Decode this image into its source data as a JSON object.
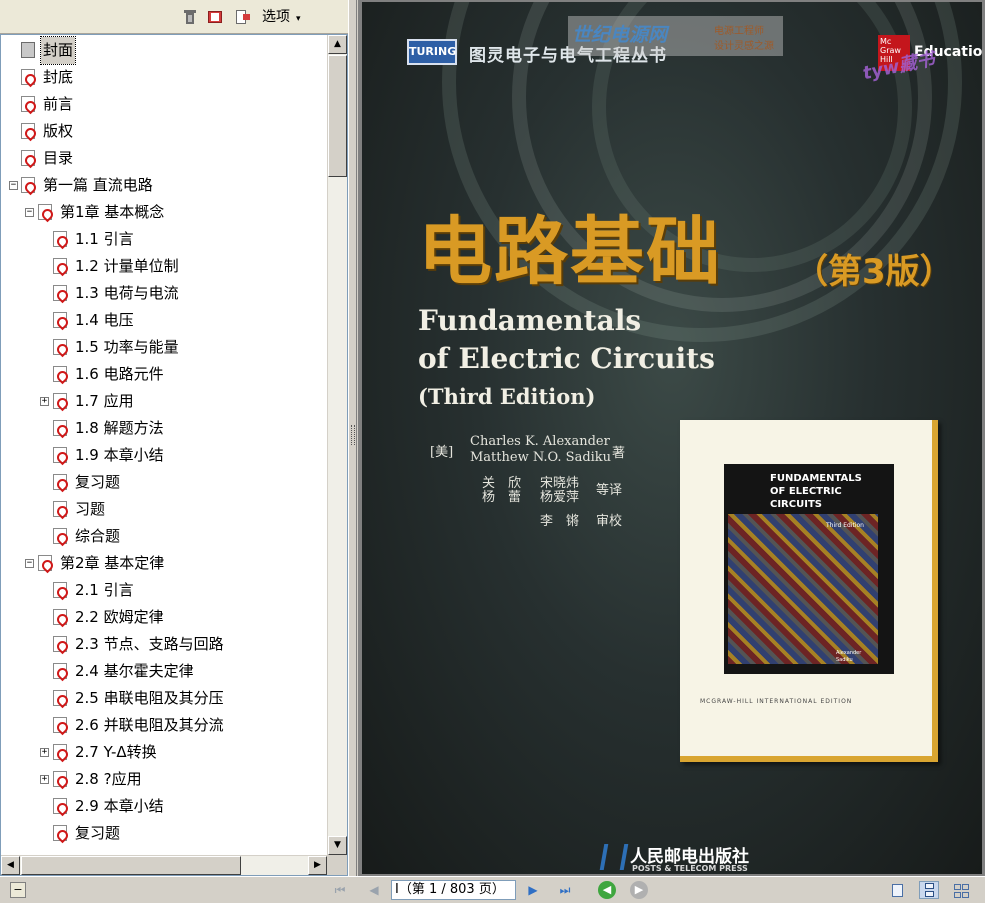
{
  "bookmarks_toolbar": {
    "options_label": "选项",
    "options_arrow": "▾"
  },
  "tree": {
    "items": [
      {
        "label": "封面",
        "selected": true
      },
      {
        "label": "封底"
      },
      {
        "label": "前言"
      },
      {
        "label": "版权"
      },
      {
        "label": "目录"
      },
      {
        "label": "第一篇 直流电路",
        "expander": "−"
      },
      {
        "label": "第1章 基本概念",
        "expander": "−"
      },
      {
        "label": "1.1 引言"
      },
      {
        "label": "1.2 计量单位制"
      },
      {
        "label": "1.3 电荷与电流"
      },
      {
        "label": "1.4 电压"
      },
      {
        "label": "1.5 功率与能量"
      },
      {
        "label": "1.6 电路元件"
      },
      {
        "label": "1.7 应用",
        "expander": "+"
      },
      {
        "label": "1.8 解题方法"
      },
      {
        "label": "1.9 本章小结"
      },
      {
        "label": "复习题"
      },
      {
        "label": "习题"
      },
      {
        "label": "综合题"
      },
      {
        "label": "第2章 基本定律",
        "expander": "−"
      },
      {
        "label": "2.1 引言"
      },
      {
        "label": "2.2 欧姆定律"
      },
      {
        "label": "2.3 节点、支路与回路"
      },
      {
        "label": "2.4 基尔霍夫定律"
      },
      {
        "label": "2.5 串联电阻及其分压"
      },
      {
        "label": "2.6 并联电阻及其分流"
      },
      {
        "label": "2.7 Y-Δ转换",
        "expander": "+"
      },
      {
        "label": "2.8 ?应用",
        "expander": "+"
      },
      {
        "label": "2.9 本章小结"
      },
      {
        "label": "复习题"
      }
    ]
  },
  "cover": {
    "series_badge": "TURING",
    "series_title": "图灵电子与电气工程丛书",
    "watermark_main": "世纪电源网",
    "watermark_sub1": "电源工程师",
    "watermark_sub2": "设计灵感之源",
    "mcgraw_logo": "Mc Graw Hill",
    "education": "Education",
    "stamp": "tyw藏书",
    "title_cn": "电路基础",
    "edition_cn": "（第3版）",
    "title_en_1": "Fundamentals",
    "title_en_2": "of Electric Circuits",
    "title_en_3": "(Third Edition)",
    "nationality": "[美]",
    "author1": "Charles K. Alexander",
    "author2": "Matthew N.O. Sadiku",
    "author_suffix": "著",
    "translator_1a": "关　欣",
    "translator_1b": "宋晓炜",
    "translator_2a": "杨　蕾",
    "translator_2b": "杨爱萍",
    "translate_suffix": "等译",
    "reviewer": "李　锵",
    "review_suffix": "审校",
    "orig_title": "FUNDAMENTALS\nOF ELECTRIC\nCIRCUITS",
    "orig_edition": "Third Edition",
    "orig_authors": "Alexander\nSadiku",
    "orig_footer": "MCGRAW-HILL INTERNATIONAL EDITION",
    "publisher_cn": "人民邮电出版社",
    "publisher_en": "POSTS & TELECOM PRESS"
  },
  "statusbar": {
    "collapse_icon": "−",
    "first": "⏮",
    "prev": "◀",
    "page_text": "I（第 1 / 803 页）",
    "next": "▶",
    "last": "⏭",
    "back": "◀",
    "forward": "▶"
  },
  "scroll": {
    "up": "▲",
    "down": "▼",
    "left": "◀",
    "right": "▶"
  },
  "colors": {
    "title_cn": "#d99a24",
    "cover_bg": "#1f2220",
    "selection": "#d4d0c8"
  }
}
